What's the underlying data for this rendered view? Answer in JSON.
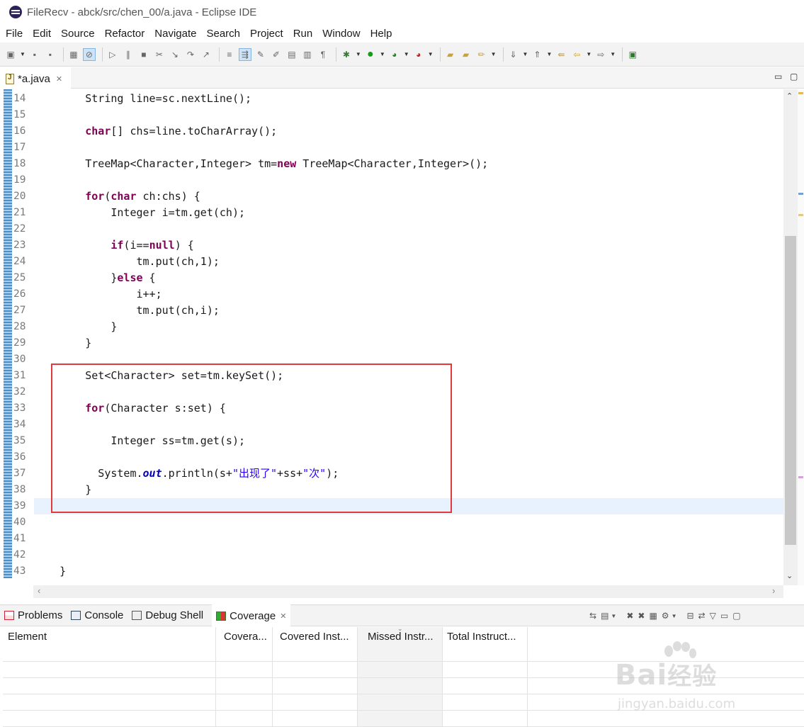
{
  "window": {
    "title": "FileRecv - abck/src/chen_00/a.java - Eclipse IDE"
  },
  "menu": [
    "File",
    "Edit",
    "Source",
    "Refactor",
    "Navigate",
    "Search",
    "Project",
    "Run",
    "Window",
    "Help"
  ],
  "editor_tab": {
    "label": "*a.java",
    "close": "✕"
  },
  "editor": {
    "lines": [
      {
        "num": "14",
        "segs": [
          [
            "",
            "        String line=sc.nextLine();"
          ]
        ]
      },
      {
        "num": "15",
        "segs": []
      },
      {
        "num": "16",
        "segs": [
          [
            "",
            "        "
          ],
          [
            "kw",
            "char"
          ],
          [
            "",
            "[] chs=line.toCharArray();"
          ]
        ]
      },
      {
        "num": "17",
        "segs": []
      },
      {
        "num": "18",
        "segs": [
          [
            "",
            "        TreeMap<Character,Integer> tm="
          ],
          [
            "kw",
            "new"
          ],
          [
            "",
            " TreeMap<Character,Integer>();"
          ]
        ]
      },
      {
        "num": "19",
        "segs": []
      },
      {
        "num": "20",
        "segs": [
          [
            "",
            "        "
          ],
          [
            "kw",
            "for"
          ],
          [
            "",
            "("
          ],
          [
            "kw",
            "char"
          ],
          [
            "",
            " ch:chs) {"
          ]
        ]
      },
      {
        "num": "21",
        "segs": [
          [
            "",
            "            Integer i=tm.get(ch);"
          ]
        ]
      },
      {
        "num": "22",
        "segs": []
      },
      {
        "num": "23",
        "segs": [
          [
            "",
            "            "
          ],
          [
            "kw",
            "if"
          ],
          [
            "",
            "(i=="
          ],
          [
            "kw",
            "null"
          ],
          [
            "",
            ") {"
          ]
        ]
      },
      {
        "num": "24",
        "segs": [
          [
            "",
            "                tm.put(ch,1);"
          ]
        ]
      },
      {
        "num": "25",
        "segs": [
          [
            "",
            "            }"
          ],
          [
            "kw",
            "else"
          ],
          [
            "",
            " {"
          ]
        ]
      },
      {
        "num": "26",
        "segs": [
          [
            "",
            "                i++;"
          ]
        ]
      },
      {
        "num": "27",
        "segs": [
          [
            "",
            "                tm.put(ch,i);"
          ]
        ]
      },
      {
        "num": "28",
        "segs": [
          [
            "",
            "            }"
          ]
        ]
      },
      {
        "num": "29",
        "segs": [
          [
            "",
            "        }"
          ]
        ]
      },
      {
        "num": "30",
        "segs": []
      },
      {
        "num": "31",
        "segs": [
          [
            "",
            "        Set<Character> set=tm.keySet();"
          ]
        ]
      },
      {
        "num": "32",
        "segs": []
      },
      {
        "num": "33",
        "segs": [
          [
            "",
            "        "
          ],
          [
            "kw",
            "for"
          ],
          [
            "",
            "(Character s:set) {"
          ]
        ]
      },
      {
        "num": "34",
        "segs": []
      },
      {
        "num": "35",
        "segs": [
          [
            "",
            "            Integer ss=tm.get(s);"
          ]
        ]
      },
      {
        "num": "36",
        "segs": []
      },
      {
        "num": "37",
        "segs": [
          [
            "",
            "          System."
          ],
          [
            "fld",
            "out"
          ],
          [
            "",
            ".println(s+"
          ],
          [
            "str",
            "\"出现了\""
          ],
          [
            "",
            "+ss+"
          ],
          [
            "str",
            "\"次\""
          ],
          [
            "",
            ");"
          ]
        ]
      },
      {
        "num": "38",
        "segs": [
          [
            "",
            "        }"
          ]
        ]
      },
      {
        "num": "39",
        "segs": [],
        "current": true
      },
      {
        "num": "40",
        "segs": []
      },
      {
        "num": "41",
        "segs": []
      },
      {
        "num": "42",
        "segs": []
      },
      {
        "num": "43",
        "segs": [
          [
            "",
            "    }"
          ]
        ]
      }
    ]
  },
  "panel": {
    "tabs": [
      {
        "label": "Problems",
        "icon": "problems-icon"
      },
      {
        "label": "Console",
        "icon": "console-icon"
      },
      {
        "label": "Debug Shell",
        "icon": "debug-shell-icon"
      },
      {
        "label": "Coverage",
        "icon": "coverage-icon",
        "active": true
      }
    ],
    "columns": [
      "Element",
      "Covera...",
      "Covered Inst...",
      "Missed Instr...",
      "Total Instruct..."
    ]
  },
  "watermark": {
    "text": "Bai",
    "cn": "经验",
    "url": "jingyan.baidu.com"
  },
  "colors": {
    "keyword": "#7f0055",
    "string": "#2a00ff",
    "static_field": "#0000c0",
    "highlight_box": "#e23a3a",
    "current_line": "#e8f2fe"
  }
}
